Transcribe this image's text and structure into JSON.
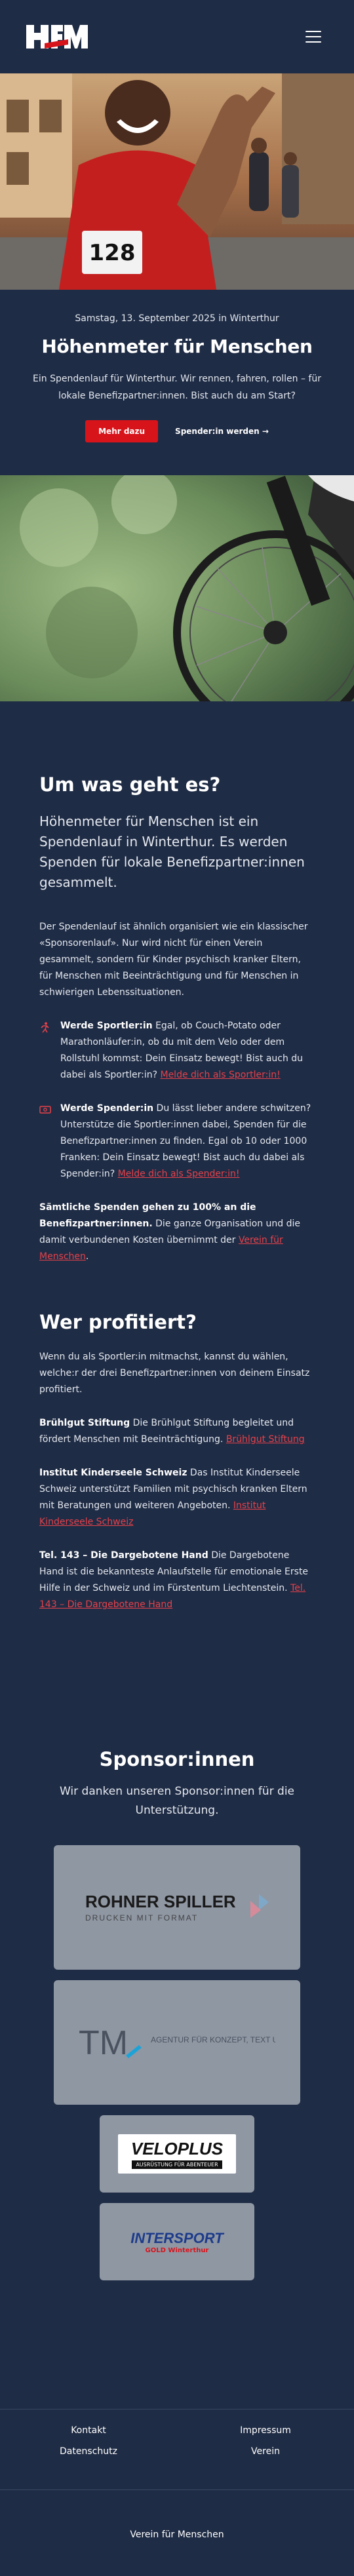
{
  "header": {
    "logo_text": "HFM",
    "menu_icon": "hamburger-icon"
  },
  "hero": {
    "bib_number": "128",
    "date": "Samstag, 13. September 2025 in Winterthur",
    "title": "Höhenmeter für Menschen",
    "subtitle": "Ein Spendenlauf für Winterthur. Wir rennen, fahren, rollen – für lokale Benefizpartner:innen. Bist auch du am Start?",
    "primary_button": "Mehr dazu",
    "secondary_link": "Spender:in werden →"
  },
  "about": {
    "title": "Um was geht es?",
    "lead": "Höhenmeter für Menschen ist ein Spendenlauf in Winterthur. Es werden Spenden für lokale Benefizpartner:innen gesammelt.",
    "intro": "Der Spendenlauf ist ähnlich organisiert wie ein klassischer «Sponsorenlauf». Nur wird nicht für einen Verein gesammelt, sondern für Kinder psychisch kranker Eltern, für Menschen mit Beeinträchtigung und für Menschen in schwierigen Lebenssituationen.",
    "features": [
      {
        "icon": "runner-icon",
        "title": "Werde Sportler:in",
        "text": " Egal, ob Couch-Potato oder Marathonläufer:in, ob du mit dem Velo oder dem Rollstuhl kommst: Dein Einsatz bewegt! Bist auch du dabei als Sportler:in? ",
        "link": "Melde dich als Sportler:in!"
      },
      {
        "icon": "money-icon",
        "title": "Werde Spender:in",
        "text": " Du lässt lieber andere schwitzen? Unterstütze die Sportler:innen dabei, Spenden für die Benefizpartner:innen zu finden. Egal ob 10 oder 1000 Franken: Dein Einsatz bewegt! Bist auch du dabei als Spender:in? ",
        "link": "Melde dich als Spender:in!"
      }
    ],
    "note_bold": "Sämtliche Spenden gehen zu 100% an die Benefizpartner:innen.",
    "note_text": " Die ganze Organisation und die damit verbundenen Kosten übernimmt der ",
    "note_link": "Verein für Menschen",
    "note_end": "."
  },
  "beneficiaries": {
    "title": "Wer profitiert?",
    "intro": "Wenn du als Sportler:in mitmachst, kannst du wählen, welche:r der drei Benefizpartner:innen von deinem Einsatz profitiert.",
    "items": [
      {
        "name": "Brühlgut Stiftung",
        "text": " Die Brühlgut Stiftung begleitet und fördert Menschen mit Beeinträchtigung. ",
        "link": "Brühlgut Stiftung"
      },
      {
        "name": "Institut Kinderseele Schweiz",
        "text": " Das Institut Kinderseele Schweiz unterstützt Familien mit psychisch kranken Eltern mit Beratungen und weiteren Angeboten. ",
        "link": "Institut Kinderseele Schweiz"
      },
      {
        "name": "Tel. 143 – Die Dargebotene Hand",
        "text": " Die Dargebotene Hand ist die bekannteste Anlaufstelle für emotionale Erste Hilfe in der Schweiz und im Fürstentum Liechtenstein. ",
        "link": "Tel. 143 – Die Dargebotene Hand"
      }
    ]
  },
  "sponsors": {
    "title": "Sponsor:innen",
    "subtitle": "Wir danken unseren Sponsor:innen für die Unterstützung.",
    "logos": [
      {
        "name": "ROHNER SPILLER",
        "tagline": "DRUCKEN MIT FORMAT"
      },
      {
        "name": "TM",
        "tagline": "AGENTUR FÜR KONZEPT, TEXT UND DESIGN"
      },
      {
        "name": "VELOPLUS",
        "tagline": "AUSRÜSTUNG FÜR ABENTEUER"
      },
      {
        "name": "INTERSPORT",
        "tagline": "GOLD Winterthur"
      }
    ]
  },
  "footer": {
    "links": [
      "Kontakt",
      "Impressum",
      "Datenschutz",
      "Verein"
    ],
    "bottom": "Verein für Menschen"
  },
  "colors": {
    "background": "#1f2c45",
    "accent": "#d8141b",
    "link": "#e6414a",
    "card": "#8f97a3"
  }
}
